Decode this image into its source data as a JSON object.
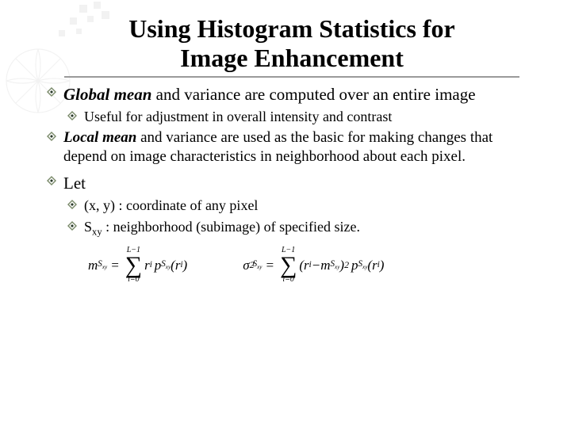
{
  "title_line1": "Using Histogram Statistics for",
  "title_line2": "Image Enhancement",
  "bullets": {
    "b1_prefix": "Global mean",
    "b1_rest": " and variance are computed over an entire image",
    "b1_sub": "Useful for adjustment in overall intensity and contrast",
    "b2_prefix": "Local mean",
    "b2_rest": " and variance are used as the basic for making changes that depend on image characteristics in neighborhood about each pixel.",
    "b3": "Let",
    "b3_sub1": "(x, y) : coordinate of any pixel",
    "b3_sub2_prefix": "S",
    "b3_sub2_sub": "xy",
    "b3_sub2_rest": " : neighborhood (subimage) of specified size."
  },
  "formula": {
    "sum_upper": "L−1",
    "sum_lower": "i=0",
    "m_lhs_var": "m",
    "m_lhs_sub": "S",
    "m_lhs_subsub": "xy",
    "sigma_lhs_var": "σ",
    "sigma_lhs_sup": "2",
    "r_i": "r",
    "r_i_sub": "i",
    "p_var": "p",
    "p_sub": "S",
    "p_subsub": "xy"
  }
}
